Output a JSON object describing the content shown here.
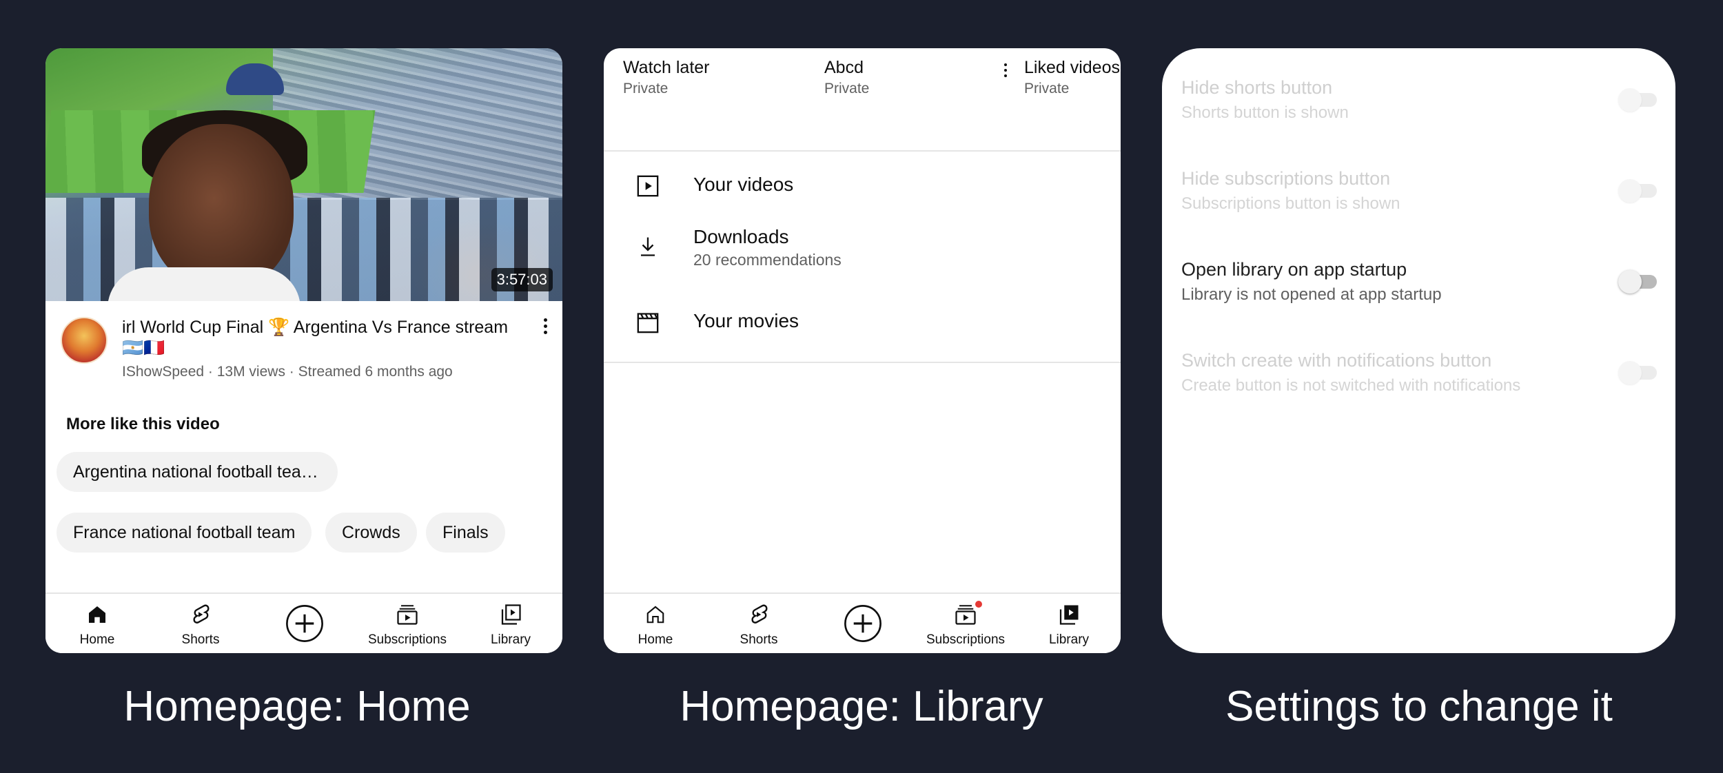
{
  "captions": [
    "Homepage: Home",
    "Homepage: Library",
    "Settings to change it"
  ],
  "home": {
    "duration": "3:57:03",
    "video_title": "irl World Cup Final 🏆 Argentina Vs France stream",
    "video_title_flags": "🇦🇷🇫🇷",
    "video_meta": "IShowSpeed · 13M views · Streamed 6 months ago",
    "more_like_label": "More like this video",
    "chips": [
      "Argentina national football tea…",
      "France national football team",
      "Crowds",
      "Finals"
    ]
  },
  "nav": {
    "items": [
      {
        "label": "Home",
        "icon": "home-icon"
      },
      {
        "label": "Shorts",
        "icon": "shorts-icon"
      },
      {
        "label": "",
        "icon": "create-icon"
      },
      {
        "label": "Subscriptions",
        "icon": "subscriptions-icon"
      },
      {
        "label": "Library",
        "icon": "library-icon"
      }
    ]
  },
  "library": {
    "playlists": [
      {
        "title": "Watch later",
        "subtitle": "Private"
      },
      {
        "title": "Abcd",
        "subtitle": "Private"
      },
      {
        "title": "Liked videos",
        "subtitle": "Private"
      }
    ],
    "rows": [
      {
        "label": "Your videos",
        "icon": "play-square-icon"
      },
      {
        "label": "Downloads",
        "sub": "20 recommendations",
        "icon": "download-icon"
      },
      {
        "label": "Your movies",
        "icon": "clapperboard-icon"
      }
    ]
  },
  "settings": {
    "items": [
      {
        "title": "Hide shorts button",
        "subtitle": "Shorts button is shown",
        "enabled": false,
        "on": false
      },
      {
        "title": "Hide subscriptions button",
        "subtitle": "Subscriptions button is shown",
        "enabled": false,
        "on": false
      },
      {
        "title": "Open library on app startup",
        "subtitle": "Library is not opened at app startup",
        "enabled": true,
        "on": false
      },
      {
        "title": "Switch create with notifications button",
        "subtitle": "Create button is not switched with notifications",
        "enabled": false,
        "on": false
      }
    ]
  },
  "colors": {
    "background": "#1b1f2d",
    "notification_dot": "#e53935"
  }
}
